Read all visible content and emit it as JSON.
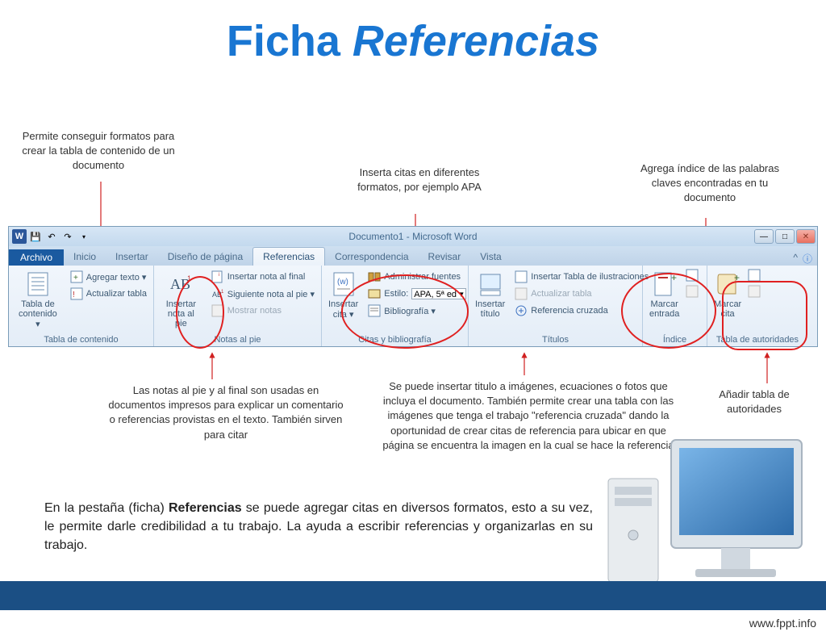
{
  "title": {
    "prefix": "Ficha ",
    "main": "Referencias"
  },
  "annotations": {
    "toc": "Permite conseguir formatos para crear la tabla de contenido de un documento",
    "citas": "Inserta citas en diferentes formatos, por ejemplo APA",
    "indice": "Agrega índice de las palabras claves encontradas en tu documento",
    "footnotes": "Las notas al pie y al final son usadas en documentos impresos para explicar un comentario o referencias provistas en el texto. También sirven para citar",
    "titles": "Se puede insertar titulo a imágenes, ecuaciones o fotos que incluya el documento. También permite crear una tabla con las imágenes que tenga el trabajo \"referencia cruzada\" dando la oportunidad de crear citas de referencia para ubicar en que página se encuentra la imagen en la cual se hace la referencia",
    "autoridades": "Añadir tabla de autoridades"
  },
  "window": {
    "title": "Documento1 - Microsoft Word"
  },
  "tabs": {
    "file": "Archivo",
    "home": "Inicio",
    "insert": "Insertar",
    "page_layout": "Diseño de página",
    "references": "Referencias",
    "mailings": "Correspondencia",
    "review": "Revisar",
    "view": "Vista"
  },
  "groups": {
    "toc": {
      "label": "Tabla de contenido",
      "main": "Tabla de\ncontenido ▾",
      "add_text": "Agregar texto ▾",
      "update": "Actualizar tabla"
    },
    "footnotes": {
      "label": "Notas al pie",
      "main": "Insertar\nnota al pie",
      "endnote": "Insertar nota al final",
      "next": "Siguiente nota al pie ▾",
      "show": "Mostrar notas"
    },
    "citations": {
      "label": "Citas y bibliografía",
      "main": "Insertar\ncita ▾",
      "manage": "Administrar fuentes",
      "style_label": "Estilo:",
      "style_value": "APA, 5ª ed ▾",
      "biblio": "Bibliografía ▾"
    },
    "captions": {
      "label": "Títulos",
      "main": "Insertar\ntítulo",
      "table_illus": "Insertar Tabla de ilustraciones",
      "update": "Actualizar tabla",
      "crossref": "Referencia cruzada"
    },
    "index": {
      "label": "Índice",
      "main": "Marcar\nentrada"
    },
    "authorities": {
      "label": "Tabla de autoridades",
      "main": "Marcar\ncita"
    }
  },
  "body_text": {
    "pre": "En la pestaña (ficha) ",
    "bold": "Referencias",
    "post": " se puede agregar citas en diversos formatos, esto a su vez, le permite darle credibilidad a tu trabajo. La ayuda a escribir referencias y organizarlas en su trabajo."
  },
  "footer": "www.fppt.info"
}
